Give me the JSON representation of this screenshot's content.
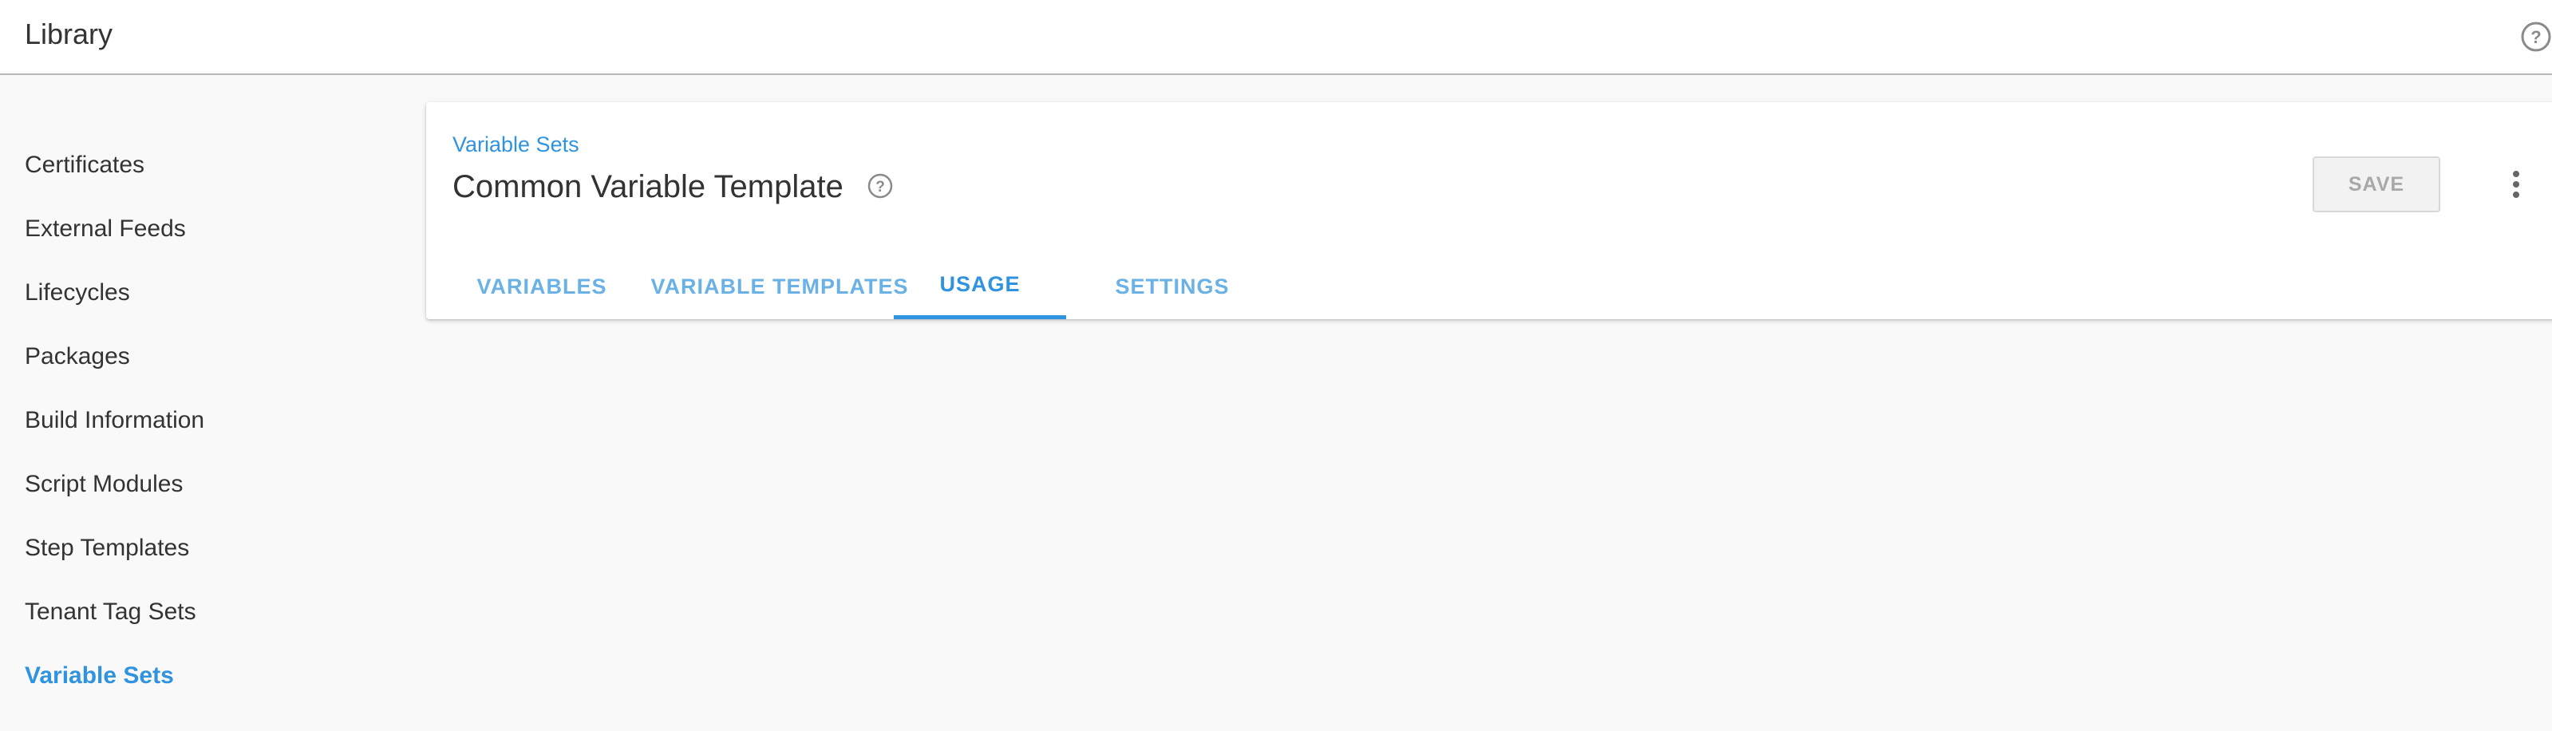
{
  "header": {
    "title": "Library",
    "help_icon": "help-circle-icon"
  },
  "sidebar": {
    "items": [
      {
        "label": "Certificates",
        "active": false
      },
      {
        "label": "External Feeds",
        "active": false
      },
      {
        "label": "Lifecycles",
        "active": false
      },
      {
        "label": "Packages",
        "active": false
      },
      {
        "label": "Build Information",
        "active": false
      },
      {
        "label": "Script Modules",
        "active": false
      },
      {
        "label": "Step Templates",
        "active": false
      },
      {
        "label": "Tenant Tag Sets",
        "active": false
      },
      {
        "label": "Variable Sets",
        "active": true
      }
    ]
  },
  "main": {
    "breadcrumb": "Variable Sets",
    "title": "Common Variable Template",
    "title_help_icon": "help-circle-icon",
    "save_label": "SAVE",
    "more_icon": "more-vertical-icon",
    "tabs": [
      {
        "label": "VARIABLES",
        "active": false
      },
      {
        "label": "VARIABLE TEMPLATES",
        "active": false
      },
      {
        "label": "USAGE",
        "active": true
      },
      {
        "label": "SETTINGS",
        "active": false
      }
    ]
  },
  "colors": {
    "accent": "#2f93e0",
    "tab_inactive": "#6ab1e6",
    "background": "#f9f9f9"
  }
}
